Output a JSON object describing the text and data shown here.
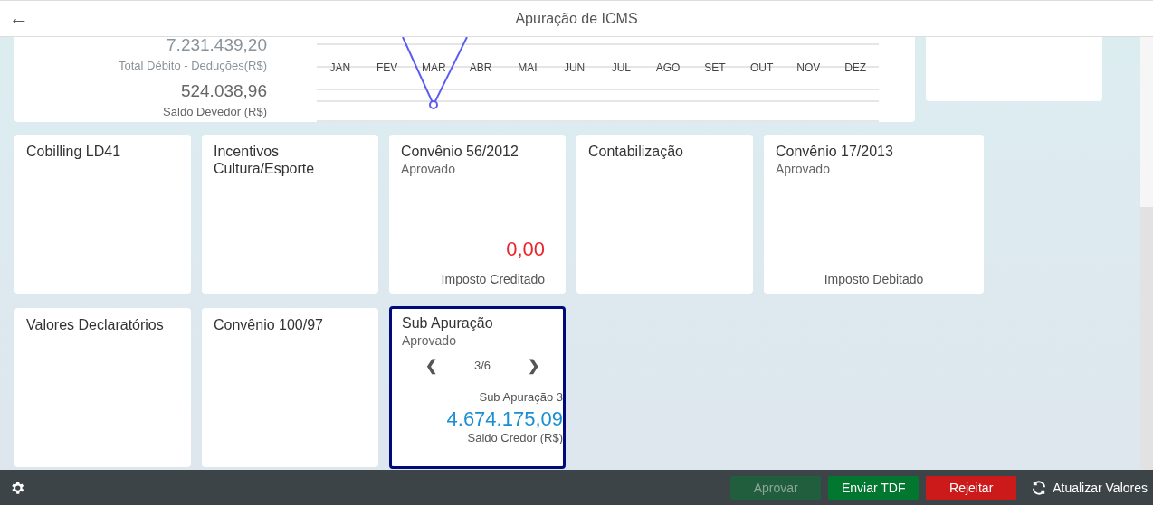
{
  "header": {
    "back": "←",
    "title": "Apuração de ICMS"
  },
  "summary": {
    "items": [
      {
        "value": "7.231.439,20",
        "caption": "Total Débito - Deduções(R$)",
        "muted": true
      },
      {
        "value": "524.038,96",
        "caption": "Saldo Devedor (R$)",
        "muted": false
      }
    ],
    "months": [
      "JAN",
      "FEV",
      "MAR",
      "ABR",
      "MAI",
      "JUN",
      "JUL",
      "AGO",
      "SET",
      "OUT",
      "NOV",
      "DEZ"
    ]
  },
  "cards": [
    {
      "kind": "plain",
      "title": "Cobilling LD41",
      "selected": false
    },
    {
      "kind": "plain",
      "title": "Incentivos Cultura/Esporte",
      "selected": false
    },
    {
      "kind": "value",
      "title": "Convênio 56/2012",
      "status": "Aprovado",
      "value": "0,00",
      "color": "#e8262b",
      "caption": "Imposto Creditado",
      "selected": false
    },
    {
      "kind": "plain",
      "title": "Contabilização",
      "selected": false
    },
    {
      "kind": "wide",
      "title": "Convênio 17/2013",
      "status": "Aprovado",
      "caption": "Imposto Debitado",
      "selected": false
    },
    {
      "kind": "plain",
      "title": "Valores Declaratórios",
      "selected": false
    },
    {
      "kind": "plain",
      "title": "Convênio 100/97",
      "selected": false
    },
    {
      "kind": "pager",
      "title": "Sub Apuração",
      "status": "Aprovado",
      "pager": {
        "prev": "❮",
        "label": "3/6",
        "next": "❯"
      },
      "subtitle": "Sub Apuração 3",
      "value": "4.674.175,09",
      "color": "#1a8fd1",
      "caption": "Saldo Credor (R$)",
      "selected": true
    }
  ],
  "footer": {
    "buttons": [
      {
        "label": "Aprovar",
        "color": "#215e3e",
        "disabled": true
      },
      {
        "label": "Enviar TDF",
        "color": "#02772f",
        "disabled": false
      },
      {
        "label": "Rejeitar",
        "color": "#cc1a1a",
        "disabled": false
      }
    ],
    "refresh": "Atualizar Valores"
  }
}
